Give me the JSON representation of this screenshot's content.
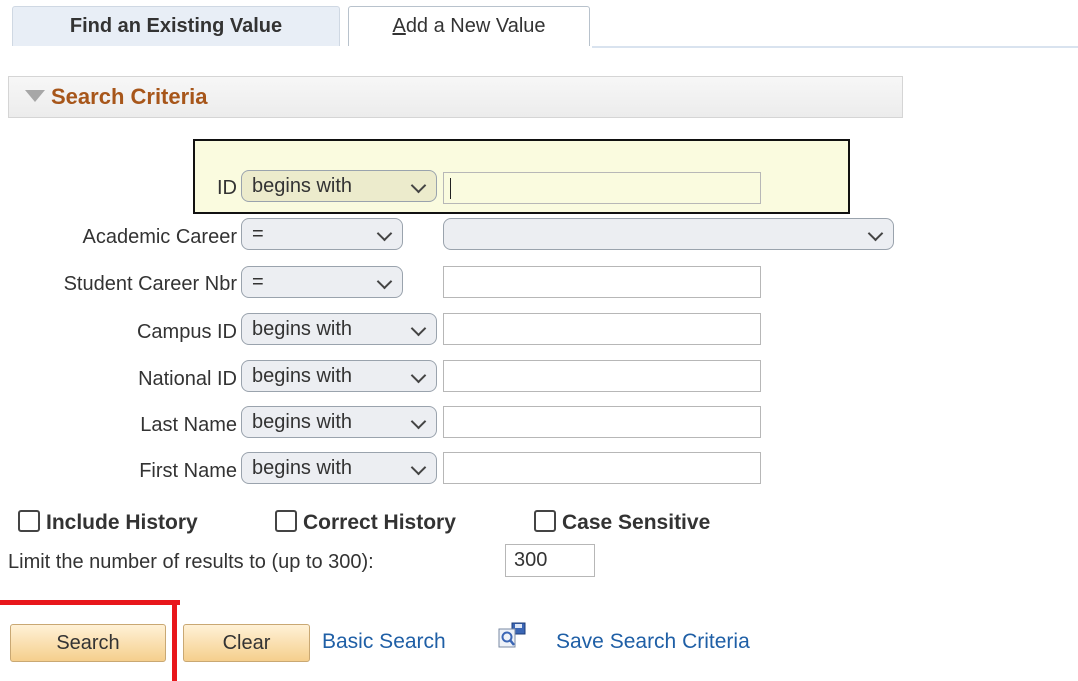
{
  "tabs": {
    "find_label": "Find an Existing Value",
    "add_label_underlined": "A",
    "add_label_rest": "dd a New Value"
  },
  "search_criteria": {
    "title": "Search Criteria"
  },
  "fields": {
    "id": {
      "label": "ID",
      "operator": "begins with",
      "value": ""
    },
    "academic_career": {
      "label": "Academic Career",
      "operator": "=",
      "value": ""
    },
    "student_career_nbr": {
      "label": "Student Career Nbr",
      "operator": "=",
      "value": ""
    },
    "campus_id": {
      "label": "Campus ID",
      "operator": "begins with",
      "value": ""
    },
    "national_id": {
      "label": "National ID",
      "operator": "begins with",
      "value": ""
    },
    "last_name": {
      "label": "Last Name",
      "operator": "begins with",
      "value": ""
    },
    "first_name": {
      "label": "First Name",
      "operator": "begins with",
      "value": ""
    }
  },
  "checkboxes": {
    "include_history": "Include History",
    "correct_history": "Correct History",
    "case_sensitive": "Case Sensitive"
  },
  "limit": {
    "label": "Limit the number of results to (up to 300):",
    "value": "300"
  },
  "actions": {
    "search": "Search",
    "clear": "Clear",
    "basic_search": "Basic Search",
    "save_search_criteria": "Save Search Criteria"
  },
  "colors": {
    "section_title": "#a7561a",
    "link": "#1f5fa6",
    "highlight_bg": "#fafbdf",
    "annotation_red": "#e8161b"
  }
}
